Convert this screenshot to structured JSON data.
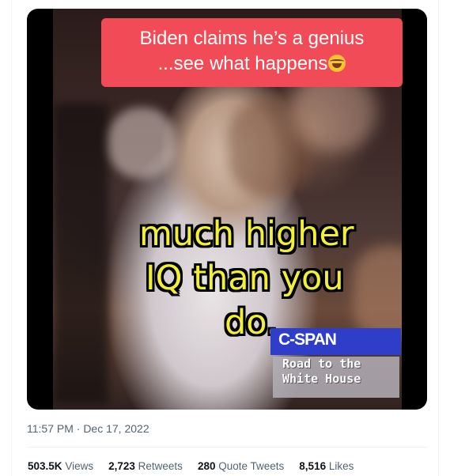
{
  "video": {
    "caption_line1": "Biden claims he’s a genius",
    "caption_line2": "...see what happens",
    "caption_emoji": "face-with-tears-of-joy-emoji",
    "subtitle_line1": "much higher",
    "subtitle_line2": "IQ than you",
    "subtitle_line3": "do.",
    "network_logo": "C-SPAN",
    "program_line1": "Road to the",
    "program_line2": "White House",
    "colors": {
      "caption_bg": "#f04b56",
      "subtitle_text": "#f1ef3a",
      "network_bar": "#2f3ec8"
    }
  },
  "tweet": {
    "timestamp": "11:57 PM · Dec 17, 2022",
    "stats": [
      {
        "value": "503.5K",
        "label": "Views"
      },
      {
        "value": "2,723",
        "label": "Retweets"
      },
      {
        "value": "280",
        "label": "Quote Tweets"
      },
      {
        "value": "8,516",
        "label": "Likes"
      }
    ]
  }
}
